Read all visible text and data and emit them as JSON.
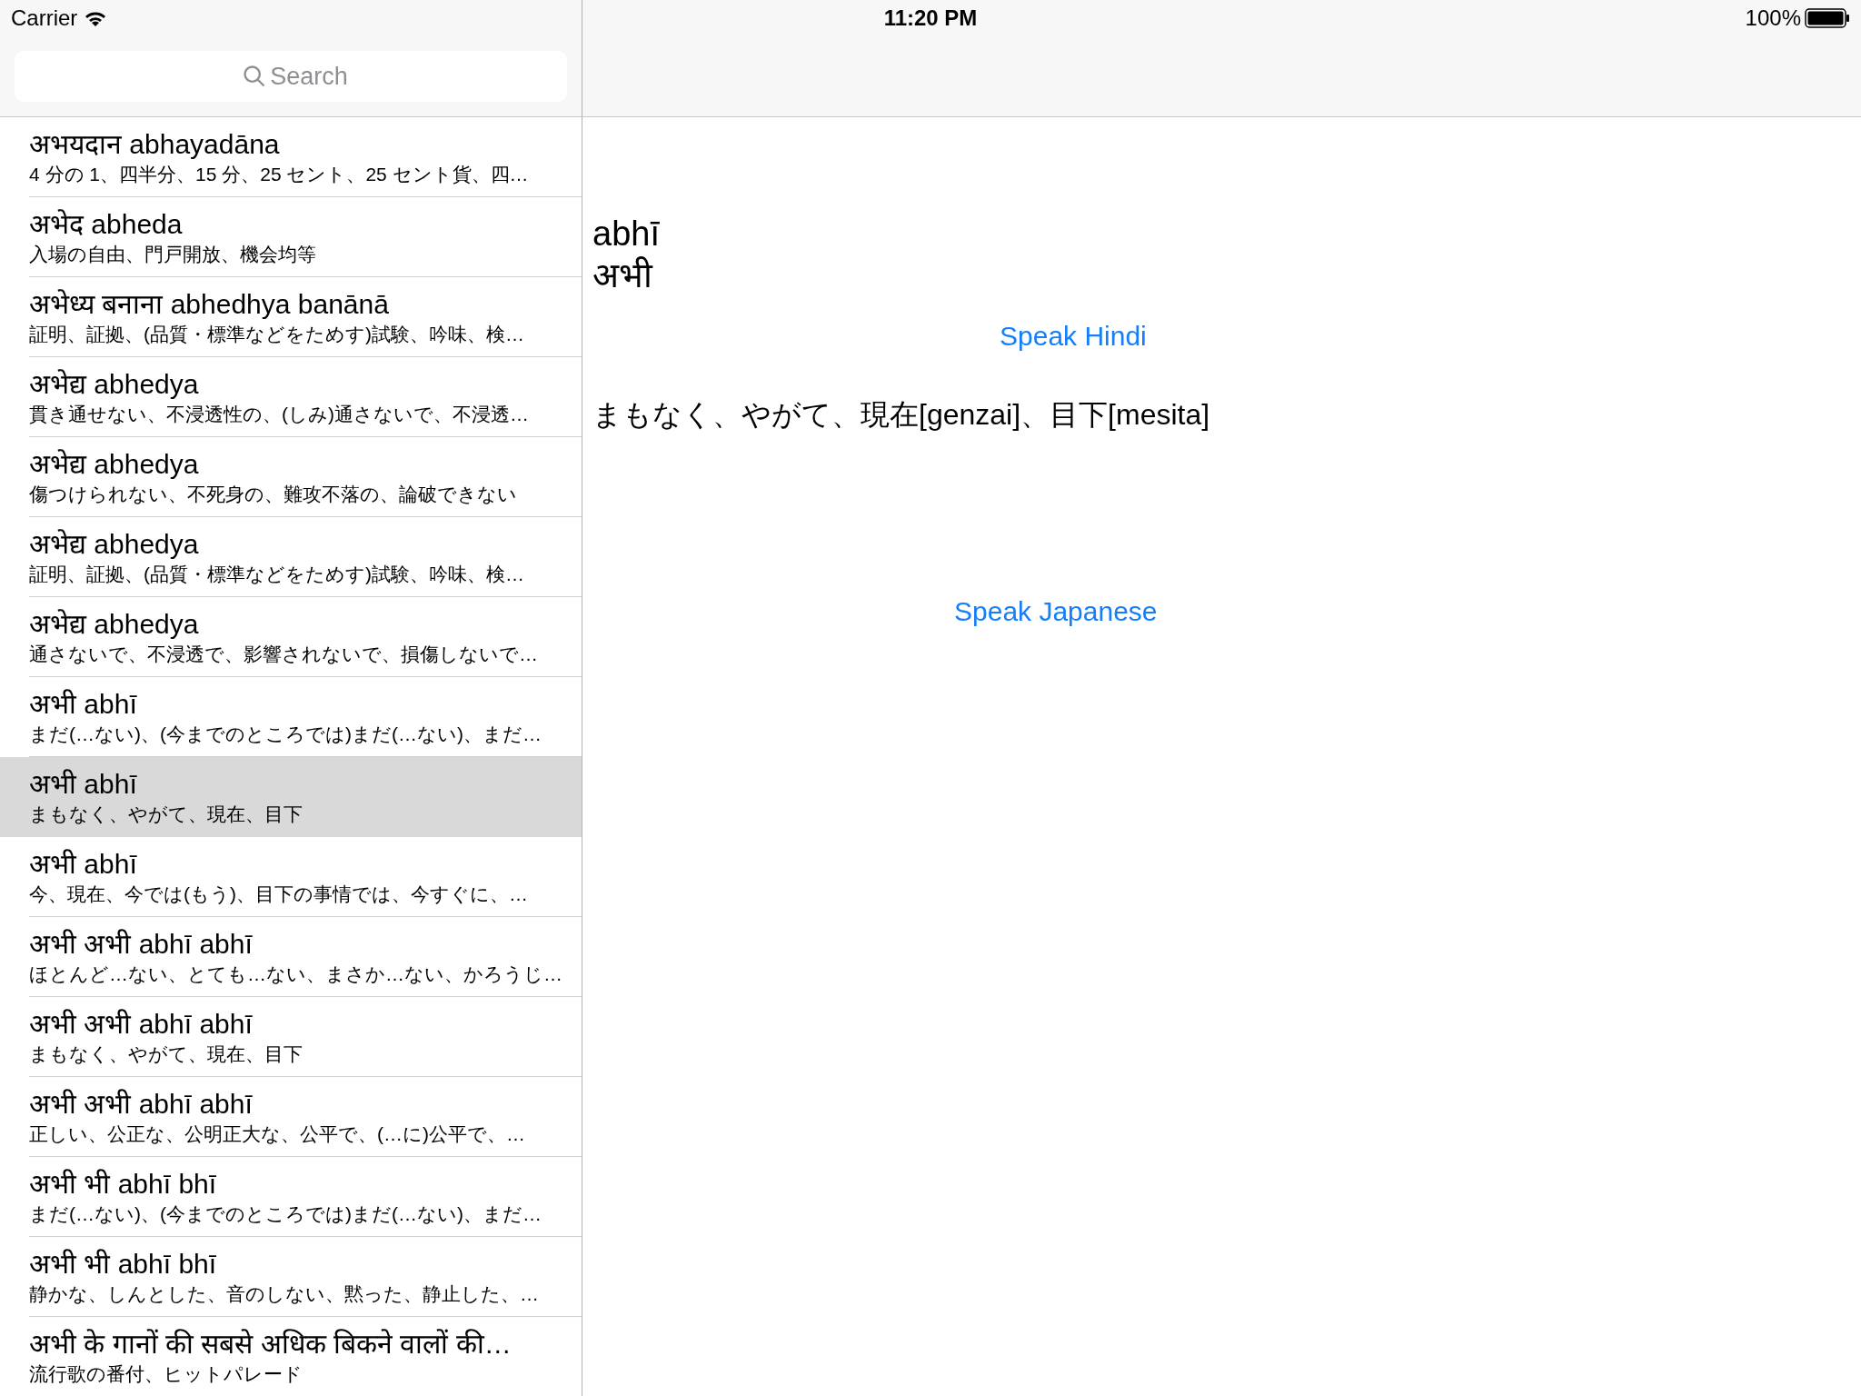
{
  "status_bar": {
    "carrier": "Carrier",
    "time": "11:20 PM",
    "battery": "100%"
  },
  "search": {
    "placeholder": "Search"
  },
  "entries": [
    {
      "title": "अभयदान abhayadāna",
      "subtitle": "4 分の 1、四半分、15 分、25 セント、25 セント貨、四…",
      "selected": false
    },
    {
      "title": "अभेद abheda",
      "subtitle": "入場の自由、門戸開放、機会均等",
      "selected": false
    },
    {
      "title": "अभेध्य बनाना abhedhya banānā",
      "subtitle": "証明、証拠、(品質・標準などをためす)試験、吟味、検…",
      "selected": false
    },
    {
      "title": "अभेद्य abhedya",
      "subtitle": "貫き通せない、不浸透性の、(しみ)通さないで、不浸透…",
      "selected": false
    },
    {
      "title": "अभेद्य abhedya",
      "subtitle": "傷つけられない、不死身の、難攻不落の、論破できない",
      "selected": false
    },
    {
      "title": "अभेद्य abhedya",
      "subtitle": "証明、証拠、(品質・標準などをためす)試験、吟味、検…",
      "selected": false
    },
    {
      "title": "अभेद्य abhedya",
      "subtitle": "通さないで、不浸透で、影響されないで、損傷しないで…",
      "selected": false
    },
    {
      "title": "अभी abhī",
      "subtitle": "まだ(…ない)、(今までのところでは)まだ(…ない)、まだ…",
      "selected": false
    },
    {
      "title": "अभी abhī",
      "subtitle": "まもなく、やがて、現在、目下",
      "selected": true
    },
    {
      "title": "अभी abhī",
      "subtitle": "今、現在、今では(もう)、目下の事情では、今すぐに、…",
      "selected": false
    },
    {
      "title": "अभी अभी abhī abhī",
      "subtitle": "ほとんど…ない、とても…ない、まさか…ない、かろうじ…",
      "selected": false
    },
    {
      "title": "अभी अभी abhī abhī",
      "subtitle": "まもなく、やがて、現在、目下",
      "selected": false
    },
    {
      "title": "अभी अभी abhī abhī",
      "subtitle": "正しい、公正な、公明正大な、公平で、(…に)公平で、…",
      "selected": false
    },
    {
      "title": "अभी भी abhī bhī",
      "subtitle": "まだ(…ない)、(今までのところでは)まだ(…ない)、まだ…",
      "selected": false
    },
    {
      "title": "अभी भी abhī bhī",
      "subtitle": "静かな、しんとした、音のしない、黙った、静止した、…",
      "selected": false
    },
    {
      "title": "अभी के गानों की सबसे अधिक बिकने वालों की…",
      "subtitle": "流行歌の番付、ヒットパレード",
      "selected": false
    }
  ],
  "detail": {
    "romanization": "abhī",
    "hindi": "अभी",
    "speak_hindi": "Speak Hindi",
    "meaning": "まもなく、やがて、現在[genzai]、目下[mesita]",
    "speak_japanese": "Speak Japanese"
  }
}
